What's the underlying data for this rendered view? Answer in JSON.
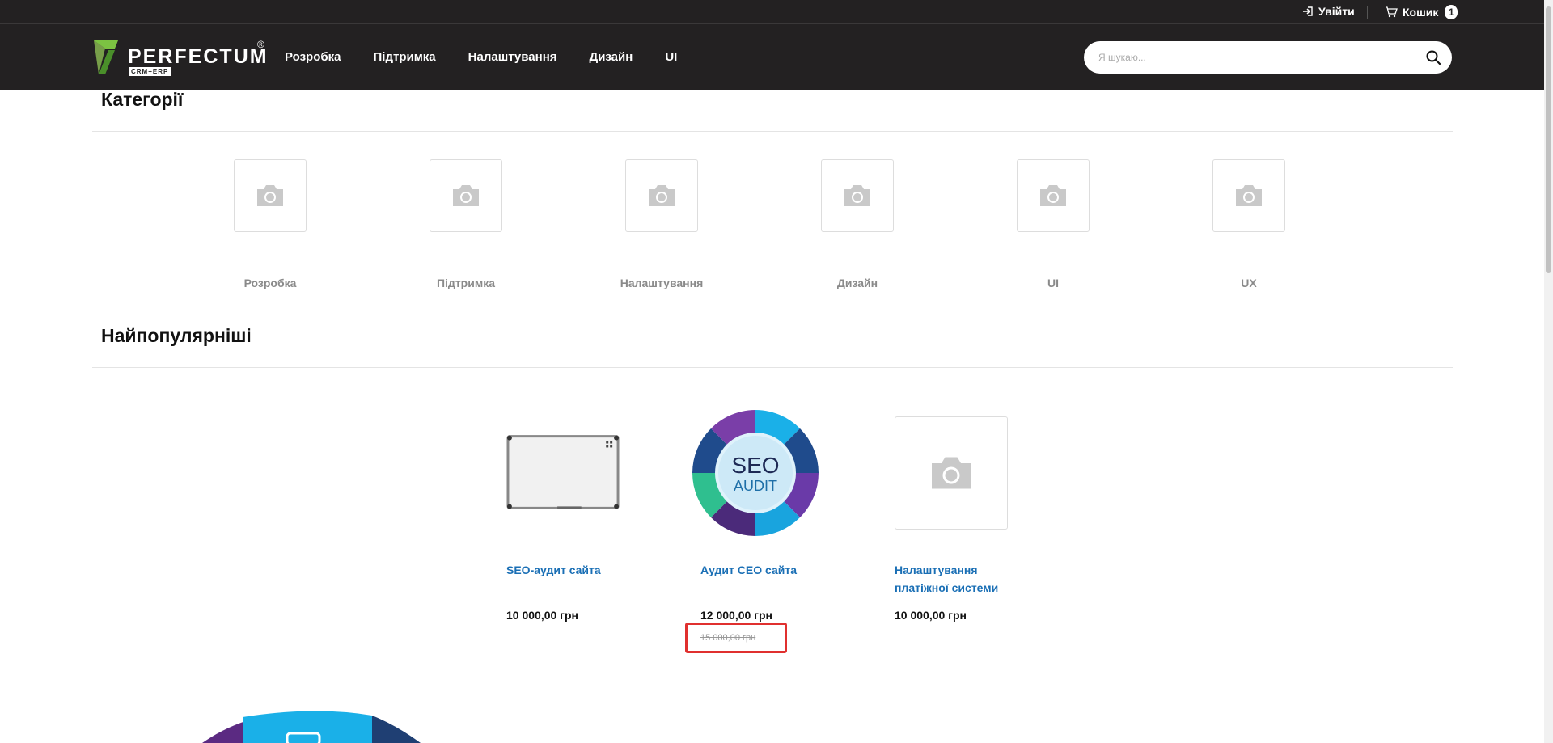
{
  "topbar": {
    "login_label": "Увійти",
    "cart_label": "Кошик",
    "cart_count": "1"
  },
  "header": {
    "logo_text": "PERFECTUM",
    "logo_reg": "®",
    "logo_sub": "CRM+ERP",
    "nav": [
      "Розробка",
      "Підтримка",
      "Налаштування",
      "Дизайн",
      "UI"
    ],
    "search_placeholder": "Я шукаю..."
  },
  "categories": {
    "title": "Категорії",
    "items": [
      "Розробка",
      "Підтримка",
      "Налаштування",
      "Дизайн",
      "UI",
      "UX"
    ]
  },
  "popular": {
    "title": "Найпопулярніші",
    "products": [
      {
        "name": "SEO-аудит сайта",
        "price": "10 000,00 грн",
        "old_price": ""
      },
      {
        "name": "Аудит СЕО сайта",
        "price": "12 000,00 грн",
        "old_price": "15 000,00 грн"
      },
      {
        "name": "Налаштування платіжної системи",
        "price": "10 000,00 грн",
        "old_price": ""
      }
    ],
    "seo_text_1": "SEO",
    "seo_text_2": "AUDIT"
  },
  "colors": {
    "header_bg": "#232122",
    "link": "#1a6fb5",
    "highlight": "#e0302f",
    "logo_green": "#7cc242"
  }
}
